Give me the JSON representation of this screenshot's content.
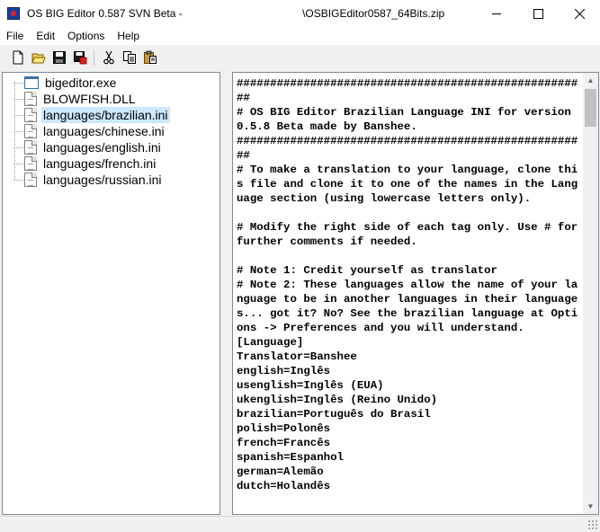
{
  "window": {
    "title_prefix": "OS BIG Editor 0.587 SVN Beta - ",
    "title_suffix": "\\OSBIGEditor0587_64Bits.zip",
    "minimize": "—",
    "maximize": "☐",
    "close": "✕"
  },
  "menu": {
    "file": "File",
    "edit": "Edit",
    "options": "Options",
    "help": "Help"
  },
  "toolbar": {
    "icons": [
      "new-file-icon",
      "open-folder-icon",
      "save-icon",
      "save-as-icon",
      "cut-icon",
      "copy-icon",
      "paste-icon"
    ]
  },
  "tree": {
    "items": [
      {
        "label": "bigeditor.exe",
        "icon": "application-icon"
      },
      {
        "label": "BLOWFISH.DLL",
        "icon": "file-icon"
      },
      {
        "label": "languages/brazilian.ini",
        "icon": "file-icon",
        "selected": true
      },
      {
        "label": "languages/chinese.ini",
        "icon": "file-icon"
      },
      {
        "label": "languages/english.ini",
        "icon": "file-icon"
      },
      {
        "label": "languages/french.ini",
        "icon": "file-icon"
      },
      {
        "label": "languages/russian.ini",
        "icon": "file-icon"
      }
    ]
  },
  "editor": {
    "content": "#####################################################\n# OS BIG Editor Brazilian Language INI for version 0.5.8 Beta made by Banshee.\n#####################################################\n# To make a translation to your language, clone this file and clone it to one of the names in the Language section (using lowercase letters only).\n\n# Modify the right side of each tag only. Use # for further comments if needed.\n\n# Note 1: Credit yourself as translator\n# Note 2: These languages allow the name of your language to be in another languages in their languages... got it? No? See the brazilian language at Options -> Preferences and you will understand.\n[Language]\nTranslator=Banshee\nenglish=Inglês\nusenglish=Inglês (EUA)\nukenglish=Inglês (Reino Unido)\nbrazilian=Português do Brasil\npolish=Polonês\nfrench=Francês\nspanish=Espanhol\ngerman=Alemão\ndutch=Holandês"
  },
  "scrollbar": {
    "up": "▲",
    "down": "▼"
  }
}
